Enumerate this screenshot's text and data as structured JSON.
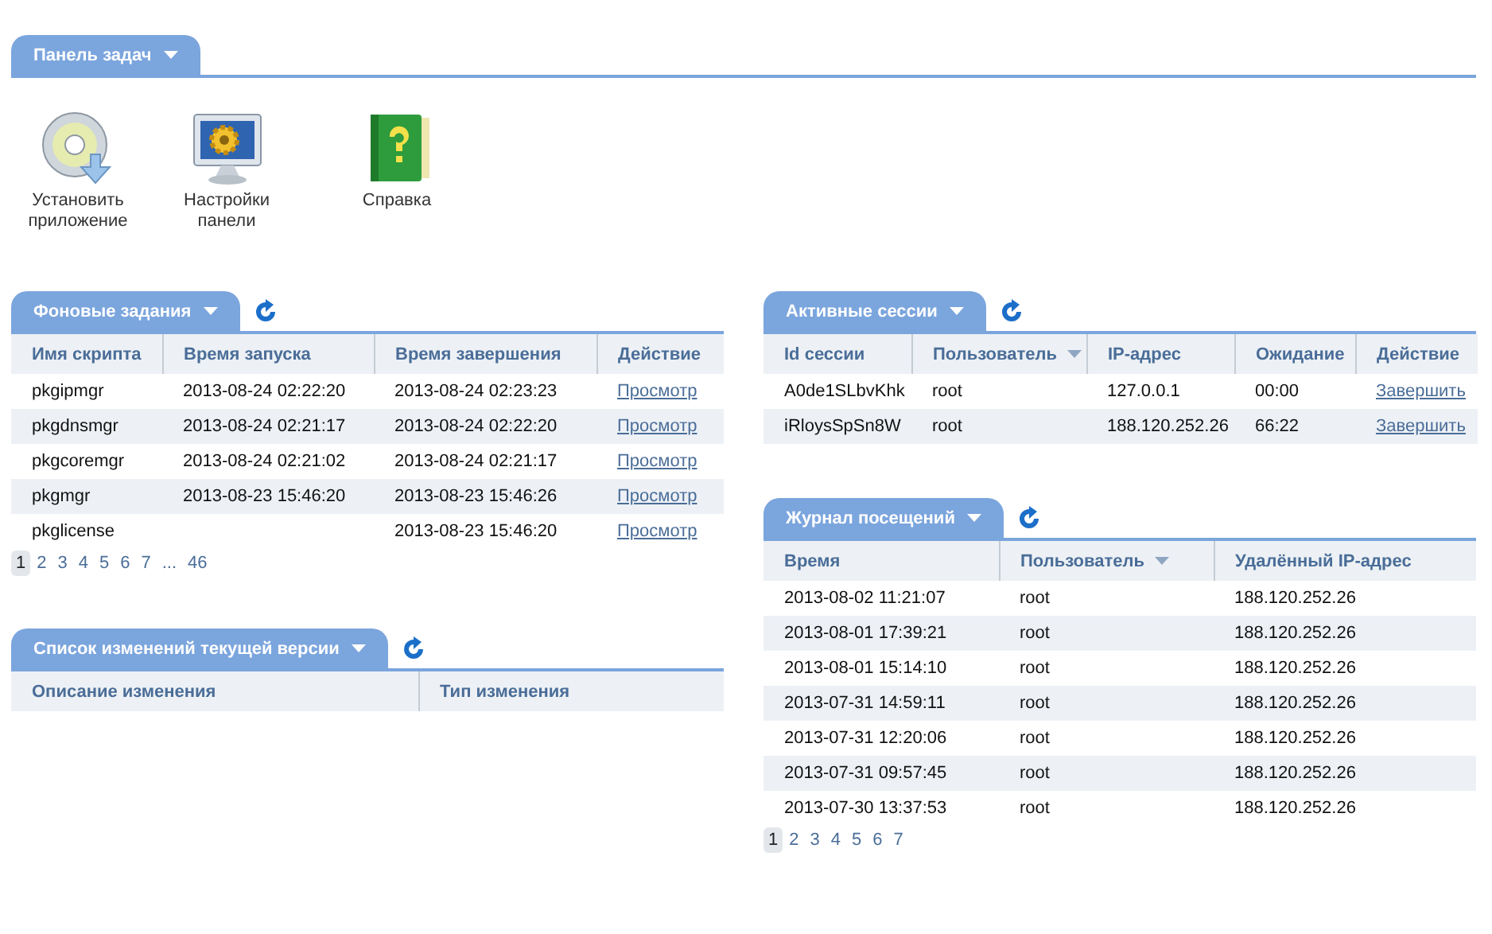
{
  "taskbar": {
    "title": "Панель задач",
    "items": [
      {
        "label": "Установить приложение",
        "kind": "install"
      },
      {
        "label": "Настройки панели",
        "kind": "settings"
      },
      {
        "label": "Справка",
        "kind": "help"
      }
    ]
  },
  "background_tasks": {
    "title": "Фоновые задания",
    "columns": [
      {
        "label": "Имя скрипта",
        "sorted": false
      },
      {
        "label": "Время запуска",
        "sorted": false
      },
      {
        "label": "Время завершения",
        "sorted": false
      },
      {
        "label": "Действие",
        "sorted": false
      }
    ],
    "rows": [
      {
        "cells": [
          "pkgipmgr",
          "2013-08-24 02:22:20",
          "2013-08-24 02:23:23"
        ],
        "action": "Просмотр"
      },
      {
        "cells": [
          "pkgdnsmgr",
          "2013-08-24 02:21:17",
          "2013-08-24 02:22:20"
        ],
        "action": "Просмотр"
      },
      {
        "cells": [
          "pkgcoremgr",
          "2013-08-24 02:21:02",
          "2013-08-24 02:21:17"
        ],
        "action": "Просмотр"
      },
      {
        "cells": [
          "pkgmgr",
          "2013-08-23 15:46:20",
          "2013-08-23 15:46:26"
        ],
        "action": "Просмотр"
      },
      {
        "cells": [
          "pkglicense",
          null,
          "2013-08-23 15:46:20"
        ],
        "action": "Просмотр"
      }
    ],
    "pages": [
      {
        "label": "1",
        "selected": true
      },
      {
        "label": "2",
        "selected": false
      },
      {
        "label": "3",
        "selected": false
      },
      {
        "label": "4",
        "selected": false
      },
      {
        "label": "5",
        "selected": false
      },
      {
        "label": "6",
        "selected": false
      },
      {
        "label": "7",
        "selected": false
      },
      {
        "label": "...",
        "selected": false
      },
      {
        "label": "46",
        "selected": false
      }
    ]
  },
  "changelog": {
    "title": "Список изменений текущей версии",
    "columns": [
      {
        "label": "Описание изменения",
        "sorted": false
      },
      {
        "label": "Тип изменения",
        "sorted": false
      }
    ]
  },
  "active_sessions": {
    "title": "Активные сессии",
    "columns": [
      {
        "label": "Id сессии",
        "sorted": false
      },
      {
        "label": "Пользователь",
        "sorted": true
      },
      {
        "label": "IP-адрес",
        "sorted": false
      },
      {
        "label": "Ожидание",
        "sorted": false
      },
      {
        "label": "Действие",
        "sorted": false
      }
    ],
    "rows": [
      {
        "cells": [
          "A0de1SLbvKhk",
          "root",
          "127.0.0.1",
          "00:00"
        ],
        "action": "Завершить"
      },
      {
        "cells": [
          "iRloysSpSn8W",
          "root",
          "188.120.252.26",
          "66:22"
        ],
        "action": "Завершить"
      }
    ]
  },
  "visit_log": {
    "title": "Журнал посещений",
    "columns": [
      {
        "label": "Время",
        "sorted": false
      },
      {
        "label": "Пользователь",
        "sorted": true
      },
      {
        "label": "Удалённый IP-адрес",
        "sorted": false
      }
    ],
    "rows": [
      {
        "cells": [
          "2013-08-02 11:21:07",
          "root",
          "188.120.252.26"
        ]
      },
      {
        "cells": [
          "2013-08-01 17:39:21",
          "root",
          "188.120.252.26"
        ]
      },
      {
        "cells": [
          "2013-08-01 15:14:10",
          "root",
          "188.120.252.26"
        ]
      },
      {
        "cells": [
          "2013-07-31 14:59:11",
          "root",
          "188.120.252.26"
        ]
      },
      {
        "cells": [
          "2013-07-31 12:20:06",
          "root",
          "188.120.252.26"
        ]
      },
      {
        "cells": [
          "2013-07-31 09:57:45",
          "root",
          "188.120.252.26"
        ]
      },
      {
        "cells": [
          "2013-07-30 13:37:53",
          "root",
          "188.120.252.26"
        ]
      }
    ],
    "pages": [
      {
        "label": "1",
        "selected": true
      },
      {
        "label": "2",
        "selected": false
      },
      {
        "label": "3",
        "selected": false
      },
      {
        "label": "4",
        "selected": false
      },
      {
        "label": "5",
        "selected": false
      },
      {
        "label": "6",
        "selected": false
      },
      {
        "label": "7",
        "selected": false
      }
    ]
  }
}
